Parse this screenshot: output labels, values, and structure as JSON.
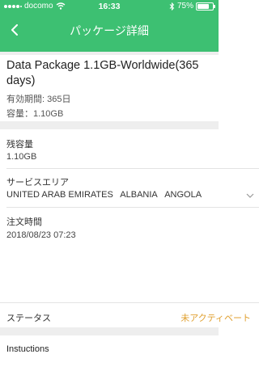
{
  "statusbar": {
    "carrier": "docomo",
    "time": "16:33",
    "battery": "75%",
    "battery_level": 0.75
  },
  "navbar": {
    "title": "パッケージ詳細"
  },
  "package": {
    "name": "Data Package 1.1GB-Worldwide(365 days)",
    "validity": "有効期間: 365日",
    "capacity": "容量：1.10GB"
  },
  "details": {
    "remaining_label": "残容量",
    "remaining_value": "1.10GB",
    "service_area_label": "サービスエリア",
    "service_areas": [
      "UNITED ARAB EMIRATES",
      "ALBANIA",
      "ANGOLA"
    ],
    "order_time_label": "注文時間",
    "order_time_value": "2018/08/23 07:23"
  },
  "status": {
    "label": "ステータス",
    "value": "未アクティベート"
  },
  "instructions": {
    "label": "Instuctions"
  },
  "colors": {
    "header": "#3dc072",
    "status_value": "#e0a030"
  },
  "icons": {
    "back": "chevron-left-icon",
    "signal": "signal-icon",
    "wifi": "wifi-icon",
    "bluetooth": "bluetooth-icon",
    "battery": "battery-icon",
    "expand": "chevron-down-icon"
  }
}
